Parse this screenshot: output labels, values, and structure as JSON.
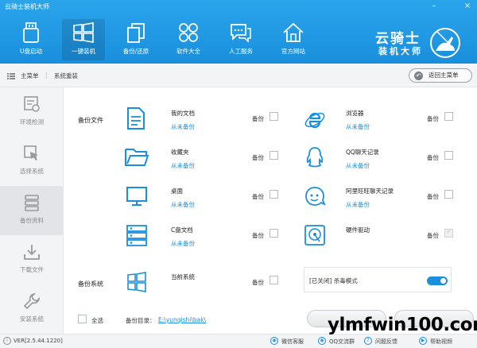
{
  "app": {
    "title": "云骑士装机大师"
  },
  "window": {
    "minimize": "–",
    "close": "×"
  },
  "nav": [
    {
      "id": "u-disk",
      "label": "U盘启动",
      "icon": "usb-drive-icon"
    },
    {
      "id": "one-click",
      "label": "一键装机",
      "icon": "windows-logo-icon",
      "active": true
    },
    {
      "id": "backup",
      "label": "备份/还原",
      "icon": "copy-pages-icon"
    },
    {
      "id": "software",
      "label": "软件大全",
      "icon": "apps-grid-icon"
    },
    {
      "id": "service",
      "label": "人工服务",
      "icon": "chat-bubble-icon"
    },
    {
      "id": "website",
      "label": "官方网站",
      "icon": "house-icon"
    }
  ],
  "brand": {
    "name": "云骑士",
    "sub": "装机大师",
    "logo": "knight-rider-logo"
  },
  "breadcrumb": {
    "root": "主菜单",
    "current": "系统重装",
    "back_label": "返回主菜单"
  },
  "sidebar": [
    {
      "label": "环境检测",
      "icon": "env-check-icon"
    },
    {
      "label": "选择系统",
      "icon": "cursor-select-icon"
    },
    {
      "label": "备份资料",
      "icon": "database-icon",
      "active": true
    },
    {
      "label": "下载文件",
      "icon": "download-icon"
    },
    {
      "label": "安装系统",
      "icon": "wrench-icon"
    }
  ],
  "sections": {
    "files": "备份文件",
    "system": "备份系统"
  },
  "backup_label": "备份",
  "items_left": [
    {
      "title": "我的文档",
      "status": "从未备份",
      "icon": "document-icon",
      "checked": false
    },
    {
      "title": "收藏夹",
      "status": "从未备份",
      "icon": "folder-icon",
      "checked": false
    },
    {
      "title": "桌面",
      "status": "从未备份",
      "icon": "monitor-icon",
      "checked": false
    },
    {
      "title": "C盘文档",
      "status": "从未备份",
      "icon": "server-disk-icon",
      "checked": false
    }
  ],
  "items_right": [
    {
      "title": "浏览器",
      "status": "从未备份",
      "icon": "ie-browser-icon",
      "checked": false
    },
    {
      "title": "QQ聊天记录",
      "status": "从未备份",
      "icon": "qq-penguin-icon",
      "checked": false
    },
    {
      "title": "阿里旺旺聊天记录",
      "status": "从未备份",
      "icon": "aliwangwang-icon",
      "checked": false
    },
    {
      "title": "硬件驱动",
      "status": "",
      "icon": "hard-drive-icon",
      "checked": true,
      "disabled": true
    }
  ],
  "system_item": {
    "title": "当前系统",
    "icon": "windows-logo-icon",
    "checked": false
  },
  "antivirus": {
    "label": "[已关闭] 杀毒模式",
    "enabled": true
  },
  "bottom": {
    "select_all": "全选",
    "dir_label": "备份目录：",
    "dir_path": "E:\\yunqishi\\bak\\"
  },
  "footer": {
    "version": "VER[2.5.44.1220]",
    "links": [
      {
        "label": "微信客服",
        "icon": "wechat-icon"
      },
      {
        "label": "QQ交流群",
        "icon": "qq-icon"
      },
      {
        "label": "问题反馈",
        "icon": "feedback-icon"
      },
      {
        "label": "帮助视频",
        "icon": "video-icon"
      }
    ]
  },
  "watermark": "ylmfwin100.com",
  "colors": {
    "header": "#1a8fdc",
    "accent": "#1a8fdc",
    "sidebar_bg": "#f3f4f6"
  }
}
